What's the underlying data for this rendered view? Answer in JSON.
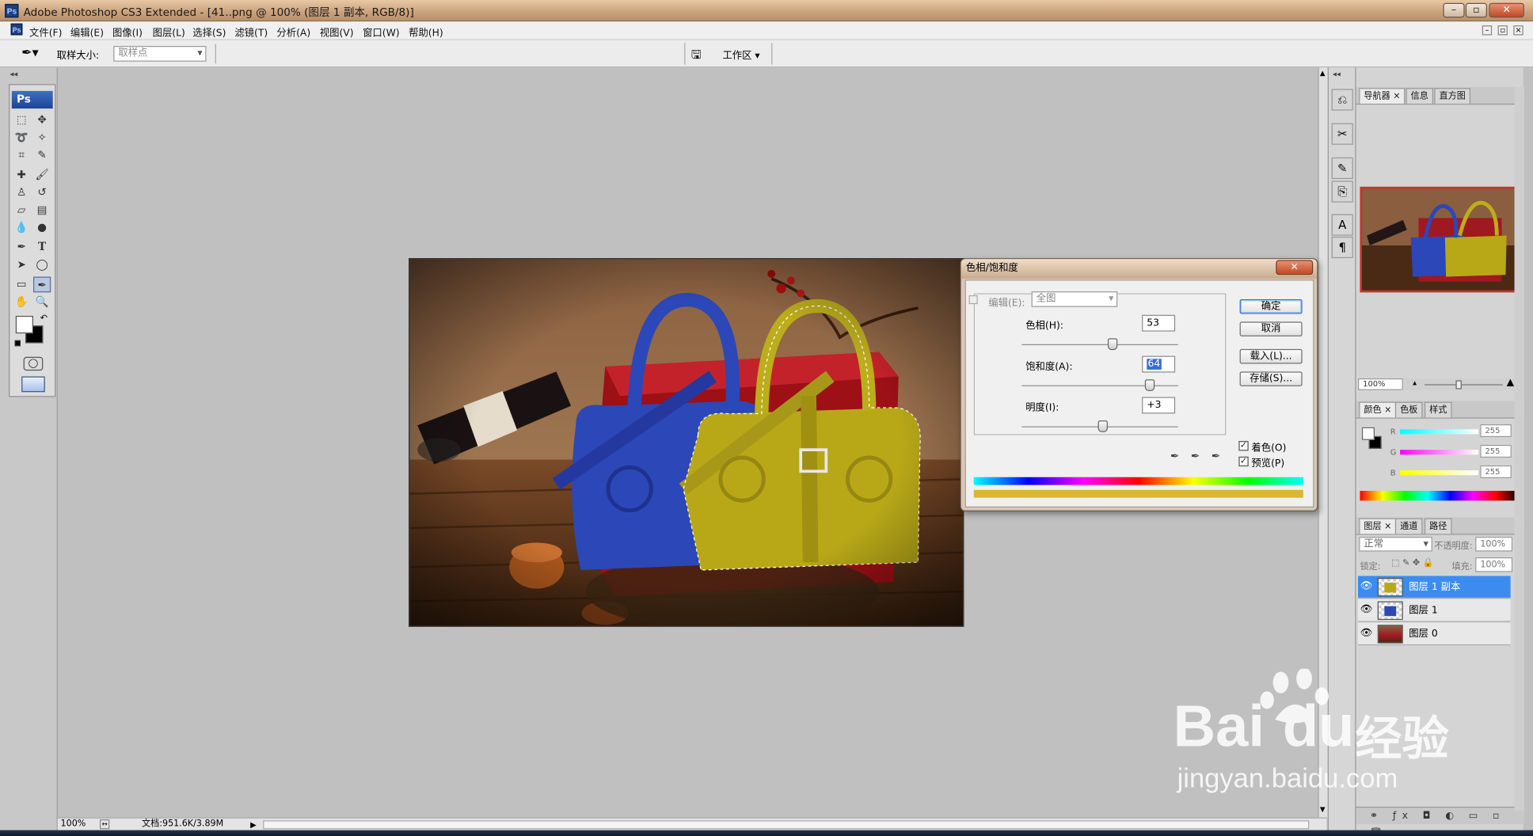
{
  "window": {
    "title": "Adobe Photoshop CS3 Extended - [41..png @ 100% (图层 1 副本, RGB/8)]",
    "app_icon": "Ps"
  },
  "menu": [
    "文件(F)",
    "编辑(E)",
    "图像(I)",
    "图层(L)",
    "选择(S)",
    "滤镜(T)",
    "分析(A)",
    "视图(V)",
    "窗口(W)",
    "帮助(H)"
  ],
  "options": {
    "sample_size_label": "取样大小:",
    "sample_size_value": "取样点",
    "workspace_label": "工作区 ▾"
  },
  "toolbox": {
    "brand": "Ps"
  },
  "status": {
    "zoom": "100%",
    "doc": "文档:951.6K/3.89M"
  },
  "dialog": {
    "title": "色相/饱和度",
    "edit_label": "编辑(E):",
    "edit_value": "全图",
    "hue_label": "色相(H):",
    "hue_value": "53",
    "hue_level": 0.58,
    "saturation_label": "饱和度(A):",
    "saturation_value": "64",
    "saturation_level": 0.82,
    "lightness_label": "明度(I):",
    "lightness_value": "+3",
    "lightness_level": 0.52,
    "ok": "确定",
    "cancel": "取消",
    "load": "载入(L)...",
    "save": "存储(S)...",
    "colorize_label": "着色(O)",
    "colorize_checked": true,
    "preview_label": "预览(P)",
    "preview_checked": true
  },
  "navigator": {
    "tabs": [
      "导航器",
      "信息",
      "直方图"
    ],
    "zoom": "100%"
  },
  "color_panel": {
    "tabs": [
      "颜色",
      "色板",
      "样式"
    ],
    "r_label": "R",
    "g_label": "G",
    "b_label": "B",
    "r": "255",
    "g": "255",
    "b": "255"
  },
  "layers": {
    "tabs": [
      "图层",
      "通道",
      "路径"
    ],
    "blend_mode": "正常",
    "opacity_label": "不透明度:",
    "opacity": "100%",
    "lock_label": "锁定:",
    "fill_label": "填充:",
    "fill": "100%",
    "items": [
      {
        "name": "图层 1 副本",
        "selected": true
      },
      {
        "name": "图层 1",
        "selected": false
      },
      {
        "name": "图层 0",
        "selected": false
      }
    ]
  },
  "watermark": {
    "brand_a": "Bai",
    "brand_b": "du",
    "brand_cn": "经验",
    "url": "jingyan.baidu.com"
  },
  "colors": {
    "accent": "#3c8cf0",
    "dialog_bg": "#f0f0f0",
    "title_warm": "#c9a27c"
  }
}
